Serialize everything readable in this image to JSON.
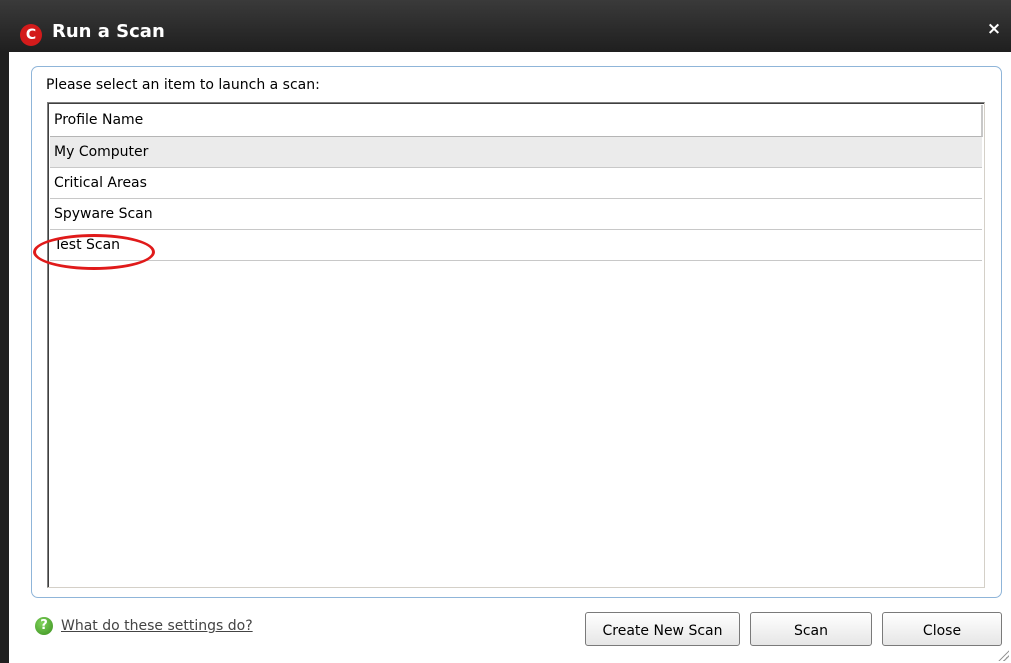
{
  "window": {
    "title": "Run a Scan",
    "logo_letter": "C",
    "close_glyph": "×"
  },
  "prompt": "Please select an item to launch a scan:",
  "list": {
    "header": "Profile Name",
    "rows": [
      "My Computer",
      "Critical Areas",
      "Spyware Scan",
      "Test Scan"
    ],
    "selected_index": 0,
    "highlighted_row": "Test Scan"
  },
  "footer": {
    "help_icon_glyph": "?",
    "help_link": "What do these settings do?",
    "buttons": {
      "create": "Create New Scan",
      "scan": "Scan",
      "close": "Close"
    }
  },
  "colors": {
    "brand": "#d31b1b",
    "annotation": "#e01a1a",
    "help_icon": "#4ea72e"
  }
}
